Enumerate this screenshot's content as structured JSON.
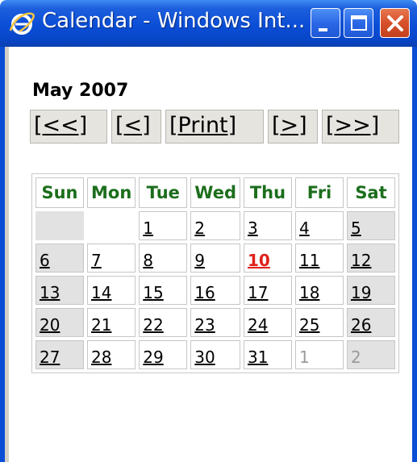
{
  "window": {
    "title": "Calendar - Windows Int...",
    "icon": "internet-explorer-icon",
    "titlebar_color": "#0a4ed6",
    "close_color": "#d6502a"
  },
  "calendar": {
    "month_title": "May 2007",
    "nav": [
      "[<<]",
      "[<]",
      "[Print]",
      "[>]",
      "[>>]"
    ],
    "weekdays": [
      "Sun",
      "Mon",
      "Tue",
      "Wed",
      "Thu",
      "Fri",
      "Sat"
    ],
    "weekday_color": "#1c6e1c",
    "today": "10",
    "today_color": "#e0201a",
    "weeks": [
      [
        "",
        "",
        "1",
        "2",
        "3",
        "4",
        "5"
      ],
      [
        "6",
        "7",
        "8",
        "9",
        "10",
        "11",
        "12"
      ],
      [
        "13",
        "14",
        "15",
        "16",
        "17",
        "18",
        "19"
      ],
      [
        "20",
        "21",
        "22",
        "23",
        "24",
        "25",
        "26"
      ],
      [
        "27",
        "28",
        "29",
        "30",
        "31",
        "1",
        "2"
      ]
    ]
  }
}
